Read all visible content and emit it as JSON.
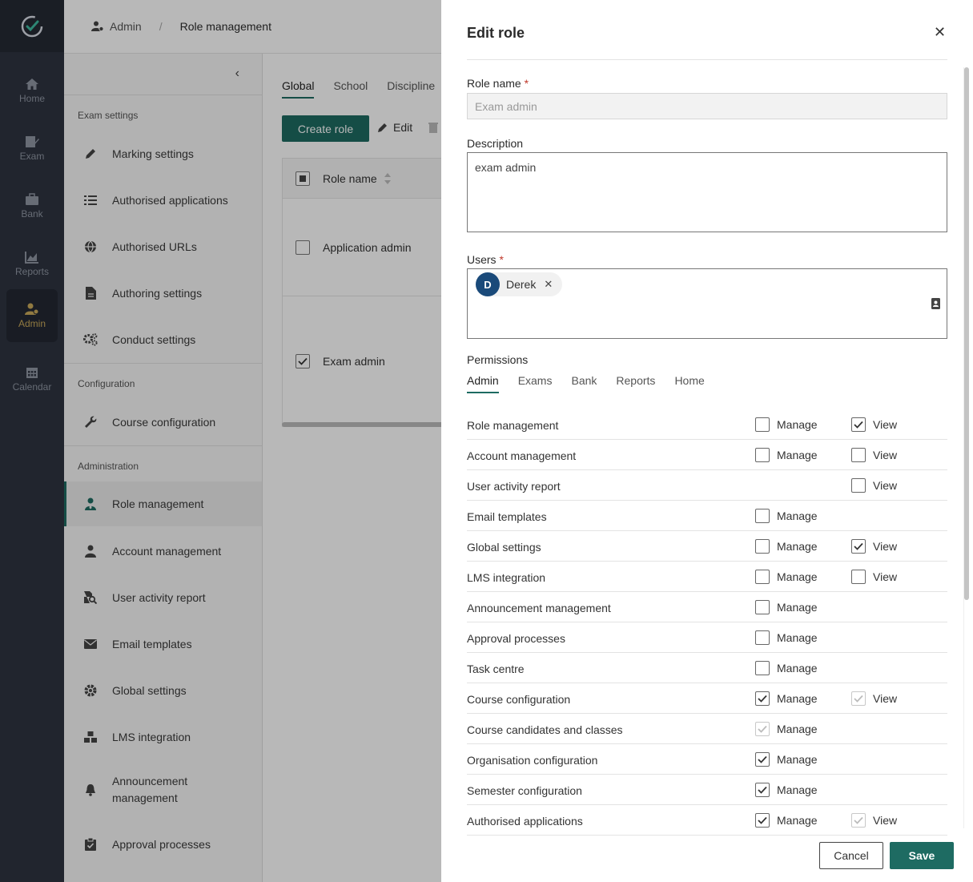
{
  "rail": {
    "items": [
      {
        "label": "Home",
        "icon": "home-icon"
      },
      {
        "label": "Exam",
        "icon": "exam-icon"
      },
      {
        "label": "Bank",
        "icon": "bank-icon"
      },
      {
        "label": "Reports",
        "icon": "reports-icon"
      },
      {
        "label": "Admin",
        "icon": "admin-icon"
      },
      {
        "label": "Calendar",
        "icon": "calendar-icon"
      }
    ],
    "active": "Admin"
  },
  "breadcrumb": {
    "parent": "Admin",
    "current": "Role management"
  },
  "settings_nav": {
    "sections": {
      "exam_settings": "Exam settings",
      "configuration": "Configuration",
      "administration": "Administration"
    },
    "items": [
      {
        "label": "Marking settings",
        "icon": "pencil-icon"
      },
      {
        "label": "Authorised applications",
        "icon": "list-icon"
      },
      {
        "label": "Authorised URLs",
        "icon": "globe-icon"
      },
      {
        "label": "Authoring settings",
        "icon": "document-icon"
      },
      {
        "label": "Conduct settings",
        "icon": "cogs-icon"
      },
      {
        "label": "Course configuration",
        "icon": "wrench-icon"
      },
      {
        "label": "Role management",
        "icon": "user-tie-icon"
      },
      {
        "label": "Account management",
        "icon": "user-icon"
      },
      {
        "label": "User activity report",
        "icon": "file-search-icon"
      },
      {
        "label": "Email templates",
        "icon": "envelope-icon"
      },
      {
        "label": "Global settings",
        "icon": "gear-icon"
      },
      {
        "label": "LMS integration",
        "icon": "cubes-icon"
      },
      {
        "label": "Announcement management",
        "icon": "bell-icon"
      },
      {
        "label": "Approval processes",
        "icon": "clipboard-check-icon"
      }
    ]
  },
  "main": {
    "tabs": [
      "Global",
      "School",
      "Discipline"
    ],
    "create_label": "Create role",
    "edit_label": "Edit",
    "table": {
      "header": "Role name",
      "rows": [
        {
          "name": "Application admin",
          "checked": false
        },
        {
          "name": "Exam admin",
          "checked": true
        }
      ]
    }
  },
  "drawer": {
    "title": "Edit role",
    "role_name_label": "Role name",
    "role_name_value": "Exam admin",
    "description_label": "Description",
    "description_value": "exam admin",
    "users_label": "Users",
    "users": [
      {
        "initial": "D",
        "name": "Derek"
      }
    ],
    "permissions_label": "Permissions",
    "permission_tabs": [
      "Admin",
      "Exams",
      "Bank",
      "Reports",
      "Home"
    ],
    "manage_label": "Manage",
    "view_label": "View",
    "permissions": [
      {
        "name": "Role management",
        "manage": false,
        "view": true
      },
      {
        "name": "Account management",
        "manage": false,
        "view": false
      },
      {
        "name": "User activity report",
        "manage": null,
        "view": false
      },
      {
        "name": "Email templates",
        "manage": false,
        "view": null
      },
      {
        "name": "Global settings",
        "manage": false,
        "view": true
      },
      {
        "name": "LMS integration",
        "manage": false,
        "view": false
      },
      {
        "name": "Announcement management",
        "manage": false,
        "view": null
      },
      {
        "name": "Approval processes",
        "manage": false,
        "view": null
      },
      {
        "name": "Task centre",
        "manage": false,
        "view": null
      },
      {
        "name": "Course configuration",
        "manage": true,
        "view": "disabled"
      },
      {
        "name": "Course candidates and classes",
        "manage": "disabled",
        "view": null
      },
      {
        "name": "Organisation configuration",
        "manage": true,
        "view": null
      },
      {
        "name": "Semester configuration",
        "manage": true,
        "view": null
      },
      {
        "name": "Authorised applications",
        "manage": true,
        "view": "disabled"
      }
    ],
    "cancel_label": "Cancel",
    "save_label": "Save"
  },
  "colors": {
    "accent": "#1e6b62",
    "rail": "#2e3440",
    "admin_active": "#c9a95a",
    "avatar": "#1a4a7a",
    "required": "#c0392b"
  }
}
